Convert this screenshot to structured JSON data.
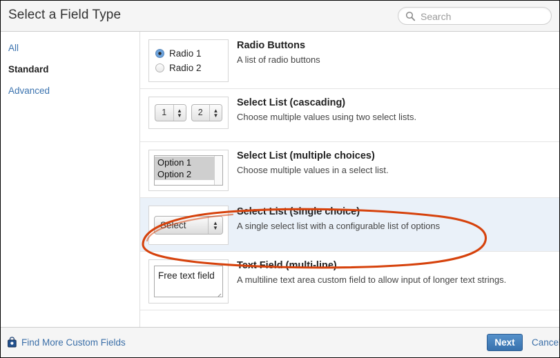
{
  "header": {
    "title": "Select a Field Type",
    "search": {
      "placeholder": "Search",
      "value": "",
      "icon": "search-icon"
    }
  },
  "sidebar": {
    "items": [
      {
        "label": "All",
        "state": "link"
      },
      {
        "label": "Standard",
        "state": "active"
      },
      {
        "label": "Advanced",
        "state": "link"
      }
    ]
  },
  "field_types": [
    {
      "title": "Radio Buttons",
      "description": "A list of radio buttons",
      "preview": {
        "kind": "radios",
        "options": [
          {
            "label": "Radio 1",
            "checked": true
          },
          {
            "label": "Radio 2",
            "checked": false
          }
        ]
      },
      "selected": false
    },
    {
      "title": "Select List (cascading)",
      "description": "Choose multiple values using two select lists.",
      "preview": {
        "kind": "cascading-selects",
        "selects": [
          {
            "value": "1"
          },
          {
            "value": "2"
          }
        ]
      },
      "selected": false
    },
    {
      "title": "Select List (multiple choices)",
      "description": "Choose multiple values in a select list.",
      "preview": {
        "kind": "multi-select",
        "options": [
          "Option 1",
          "Option 2"
        ]
      },
      "selected": false
    },
    {
      "title": "Select List (single choice)",
      "description": "A single select list with a configurable list of options",
      "preview": {
        "kind": "single-select",
        "value": "Select"
      },
      "selected": true
    },
    {
      "title": "Text Field (multi-line)",
      "description": "A multiline text area custom field to allow input of longer text strings.",
      "preview": {
        "kind": "textarea",
        "value": "Free text field"
      },
      "selected": false
    }
  ],
  "annotation": {
    "kind": "hand-drawn-ellipse",
    "color": "#d6420c",
    "targets_row_title": "Select List (single choice)"
  },
  "footer": {
    "find_more_label": "Find More Custom Fields",
    "find_more_icon": "shopping-bag-icon",
    "next_label": "Next",
    "cancel_label": "Cancel"
  },
  "colors": {
    "accent_blue": "#3b73af",
    "selected_row_bg": "#eaf1f9",
    "annotation_red": "#d6420c",
    "header_bg": "#f5f5f5"
  }
}
